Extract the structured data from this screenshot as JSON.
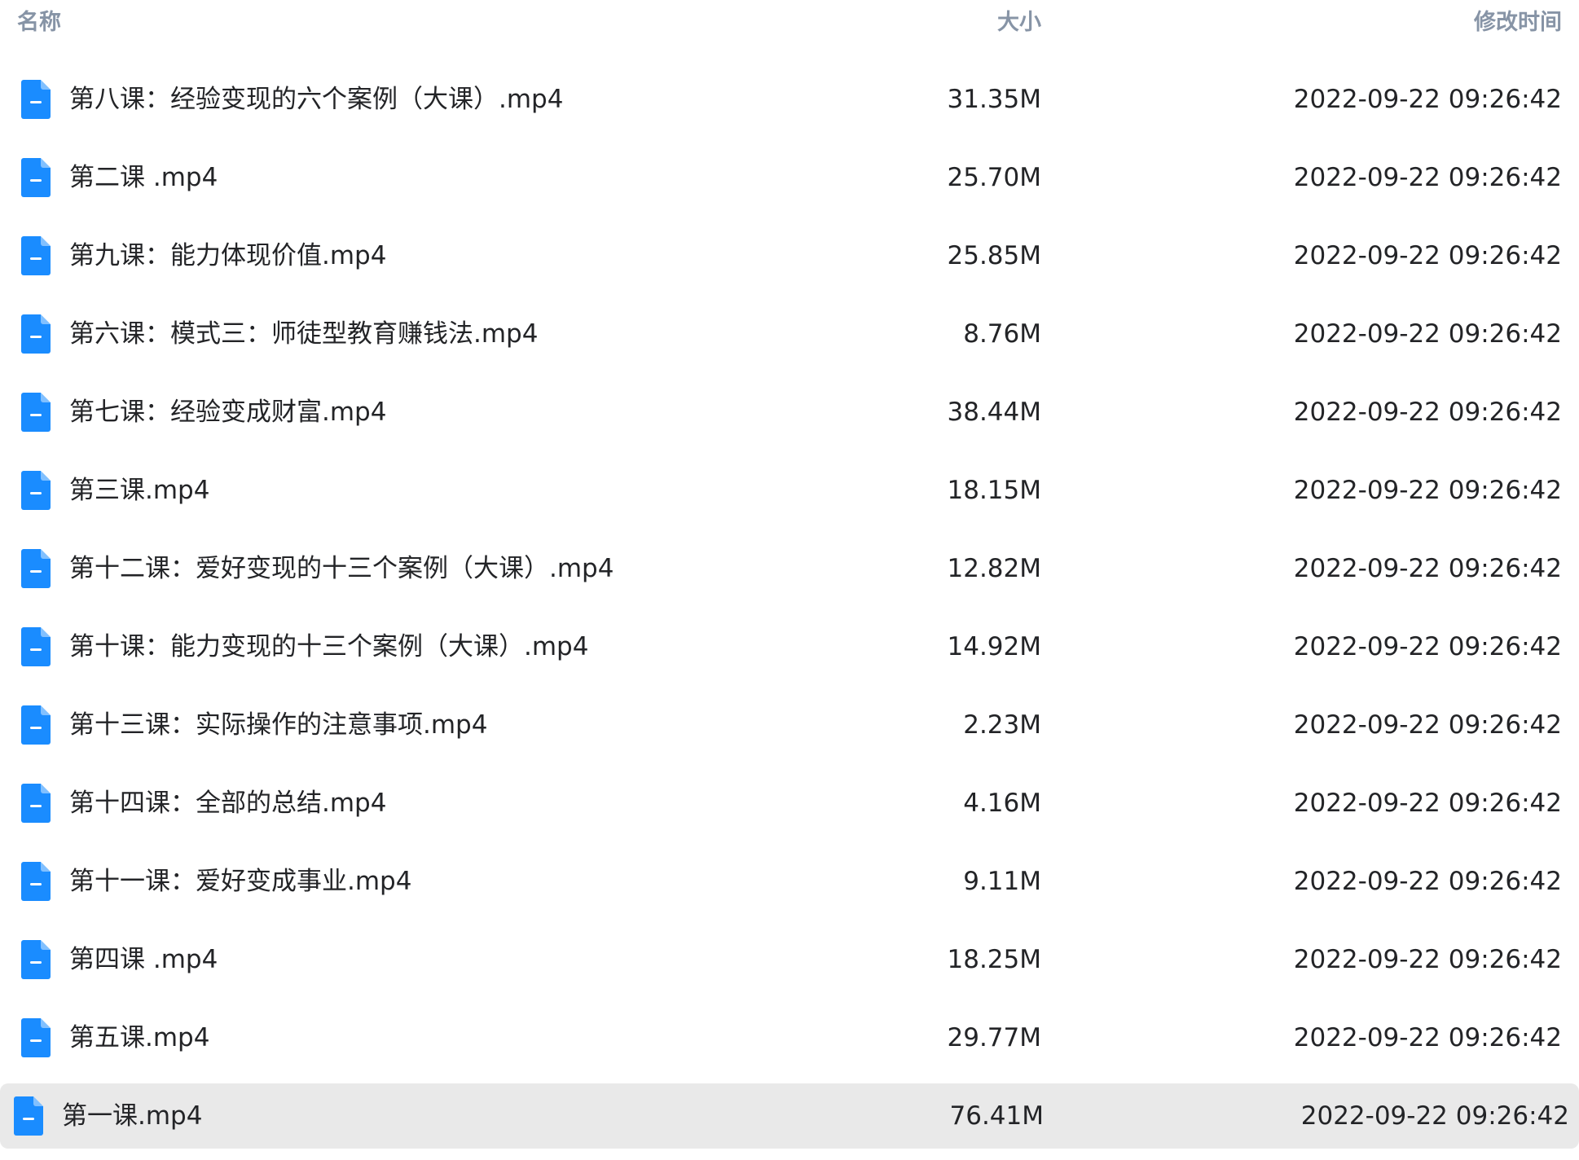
{
  "header": {
    "name_label": "名称",
    "size_label": "大小",
    "time_label": "修改时间"
  },
  "colors": {
    "icon_blue": "#1a8cff",
    "header_text": "#8794a6",
    "row_text": "#232427",
    "selected_bg": "#e9e9e9"
  },
  "files": [
    {
      "name": "第八课：经验变现的六个案例（大课）.mp4",
      "size": "31.35M",
      "time": "2022-09-22 09:26:42",
      "icon": "file-document-icon"
    },
    {
      "name": "第二课 .mp4",
      "size": "25.70M",
      "time": "2022-09-22 09:26:42",
      "icon": "file-document-icon"
    },
    {
      "name": "第九课：能力体现价值.mp4",
      "size": "25.85M",
      "time": "2022-09-22 09:26:42",
      "icon": "file-document-icon"
    },
    {
      "name": "第六课：模式三：师徒型教育赚钱法.mp4",
      "size": "8.76M",
      "time": "2022-09-22 09:26:42",
      "icon": "file-document-icon"
    },
    {
      "name": "第七课：经验变成财富.mp4",
      "size": "38.44M",
      "time": "2022-09-22 09:26:42",
      "icon": "file-document-icon"
    },
    {
      "name": "第三课.mp4",
      "size": "18.15M",
      "time": "2022-09-22 09:26:42",
      "icon": "file-document-icon"
    },
    {
      "name": "第十二课：爱好变现的十三个案例（大课）.mp4",
      "size": "12.82M",
      "time": "2022-09-22 09:26:42",
      "icon": "file-document-icon"
    },
    {
      "name": "第十课：能力变现的十三个案例（大课）.mp4",
      "size": "14.92M",
      "time": "2022-09-22 09:26:42",
      "icon": "file-document-icon"
    },
    {
      "name": "第十三课：实际操作的注意事项.mp4",
      "size": "2.23M",
      "time": "2022-09-22 09:26:42",
      "icon": "file-document-icon"
    },
    {
      "name": "第十四课：全部的总结.mp4",
      "size": "4.16M",
      "time": "2022-09-22 09:26:42",
      "icon": "file-document-icon"
    },
    {
      "name": "第十一课：爱好变成事业.mp4",
      "size": "9.11M",
      "time": "2022-09-22 09:26:42",
      "icon": "file-document-icon"
    },
    {
      "name": "第四课 .mp4",
      "size": "18.25M",
      "time": "2022-09-22 09:26:42",
      "icon": "file-document-icon"
    },
    {
      "name": "第五课.mp4",
      "size": "29.77M",
      "time": "2022-09-22 09:26:42",
      "icon": "file-document-icon"
    },
    {
      "name": "第一课.mp4",
      "size": "76.41M",
      "time": "2022-09-22 09:26:42",
      "icon": "file-document-icon",
      "selected": true
    }
  ]
}
